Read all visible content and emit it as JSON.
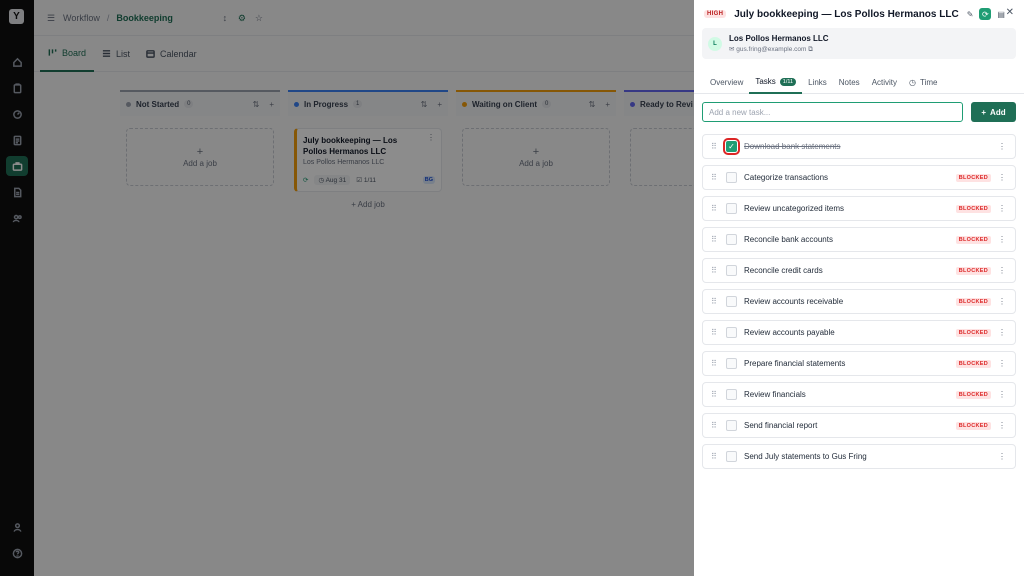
{
  "rail": {
    "logo": "Y",
    "items": [
      {
        "icon": "home-icon"
      },
      {
        "icon": "clipboard-icon"
      },
      {
        "icon": "gauge-icon"
      },
      {
        "icon": "document-icon"
      },
      {
        "icon": "briefcase-icon",
        "active": true
      },
      {
        "icon": "file-icon"
      },
      {
        "icon": "users-icon"
      }
    ],
    "bottom": [
      {
        "icon": "user-icon"
      },
      {
        "icon": "help-icon"
      }
    ]
  },
  "breadcrumb": {
    "root": "Workflow",
    "separator": "/",
    "current": "Bookkeeping"
  },
  "views": [
    {
      "label": "Board",
      "active": true
    },
    {
      "label": "List"
    },
    {
      "label": "Calendar"
    }
  ],
  "columns": [
    {
      "name": "Not Started",
      "count": "0",
      "color": "#9ca3af",
      "add_label": "Add a job"
    },
    {
      "name": "In Progress",
      "count": "1",
      "color": "#3b82f6",
      "add_label": "Add job"
    },
    {
      "name": "Waiting on Client",
      "count": "0",
      "color": "#f59e0b",
      "add_label": "Add a job"
    },
    {
      "name": "Ready to Revi",
      "count": "",
      "color": "#6366f1"
    }
  ],
  "job_card": {
    "title": "July bookkeeping — Los Pollos Hermanos LLC",
    "client": "Los Pollos Hermanos LLC",
    "date": "Aug 31",
    "progress": "1/11",
    "assignee": "BG"
  },
  "drawer": {
    "priority": "HIGH",
    "title": "July bookkeeping — Los Pollos Hermanos LLC",
    "client_initial": "L",
    "client_name": "Los Pollos Hermanos LLC",
    "client_email": "gus.fring@example.com",
    "tabs": [
      {
        "label": "Overview"
      },
      {
        "label": "Tasks",
        "count": "1/11",
        "active": true
      },
      {
        "label": "Links"
      },
      {
        "label": "Notes"
      },
      {
        "label": "Activity"
      },
      {
        "label": "Time"
      }
    ],
    "new_task_placeholder": "Add a new task...",
    "add_label": "Add",
    "blocked_label": "BLOCKED",
    "tasks": [
      {
        "name": "Download bank statements",
        "done": true,
        "blocked": false
      },
      {
        "name": "Categorize transactions",
        "done": false,
        "blocked": true
      },
      {
        "name": "Review uncategorized items",
        "done": false,
        "blocked": true
      },
      {
        "name": "Reconcile bank accounts",
        "done": false,
        "blocked": true
      },
      {
        "name": "Reconcile credit cards",
        "done": false,
        "blocked": true
      },
      {
        "name": "Review accounts receivable",
        "done": false,
        "blocked": true
      },
      {
        "name": "Review accounts payable",
        "done": false,
        "blocked": true
      },
      {
        "name": "Prepare financial statements",
        "done": false,
        "blocked": true
      },
      {
        "name": "Review financials",
        "done": false,
        "blocked": true
      },
      {
        "name": "Send financial report",
        "done": false,
        "blocked": true
      },
      {
        "name": "Send July statements to Gus Fring",
        "done": false,
        "blocked": false
      }
    ]
  }
}
